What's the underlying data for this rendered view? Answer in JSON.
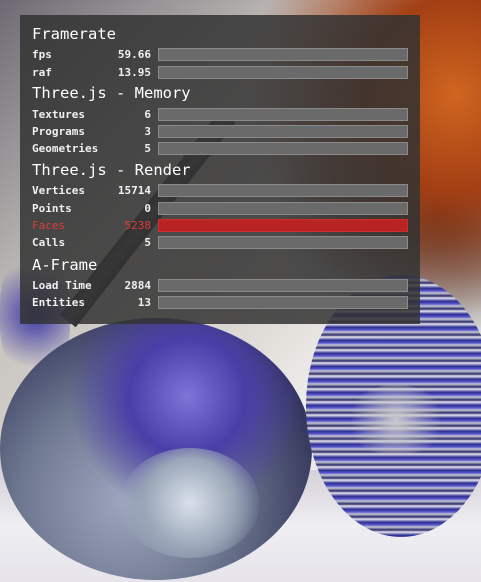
{
  "stats_panel": {
    "sections": [
      {
        "title": "Framerate",
        "rows": [
          {
            "label": "fps",
            "value": "59.66",
            "alarm": false
          },
          {
            "label": "raf",
            "value": "13.95",
            "alarm": false
          }
        ]
      },
      {
        "title": "Three.js - Memory",
        "rows": [
          {
            "label": "Textures",
            "value": "6",
            "alarm": false
          },
          {
            "label": "Programs",
            "value": "3",
            "alarm": false
          },
          {
            "label": "Geometries",
            "value": "5",
            "alarm": false
          }
        ]
      },
      {
        "title": "Three.js - Render",
        "rows": [
          {
            "label": "Vertices",
            "value": "15714",
            "alarm": false
          },
          {
            "label": "Points",
            "value": "0",
            "alarm": false
          },
          {
            "label": "Faces",
            "value": "5238",
            "alarm": true
          },
          {
            "label": "Calls",
            "value": "5",
            "alarm": false
          }
        ]
      },
      {
        "title": "A-Frame",
        "rows": [
          {
            "label": "Load Time",
            "value": "2884",
            "alarm": false
          },
          {
            "label": "Entities",
            "value": "13",
            "alarm": false
          }
        ]
      }
    ]
  },
  "colors": {
    "panel_background": "#323232",
    "text": "#ffffff",
    "bar": "#6a6a6a",
    "alarm": "#b82424",
    "alarm_text": "#e03a3a"
  }
}
